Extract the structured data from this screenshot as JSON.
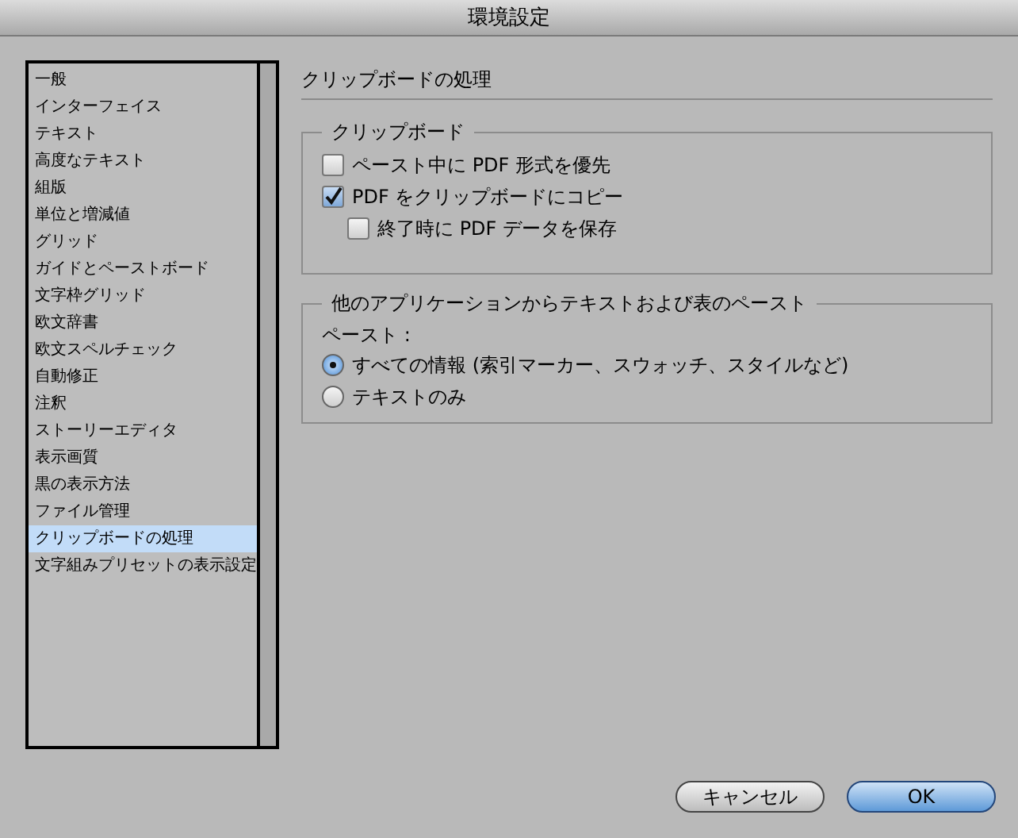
{
  "window": {
    "title": "環境設定"
  },
  "sidebar": {
    "items": [
      {
        "label": "一般",
        "selected": false
      },
      {
        "label": "インターフェイス",
        "selected": false
      },
      {
        "label": "テキスト",
        "selected": false
      },
      {
        "label": "高度なテキスト",
        "selected": false
      },
      {
        "label": "組版",
        "selected": false
      },
      {
        "label": "単位と増減値",
        "selected": false
      },
      {
        "label": "グリッド",
        "selected": false
      },
      {
        "label": "ガイドとペーストボード",
        "selected": false
      },
      {
        "label": "文字枠グリッド",
        "selected": false
      },
      {
        "label": "欧文辞書",
        "selected": false
      },
      {
        "label": "欧文スペルチェック",
        "selected": false
      },
      {
        "label": "自動修正",
        "selected": false
      },
      {
        "label": "注釈",
        "selected": false
      },
      {
        "label": "ストーリーエディタ",
        "selected": false
      },
      {
        "label": "表示画質",
        "selected": false
      },
      {
        "label": "黒の表示方法",
        "selected": false
      },
      {
        "label": "ファイル管理",
        "selected": false
      },
      {
        "label": "クリップボードの処理",
        "selected": true
      },
      {
        "label": "文字組みプリセットの表示設定",
        "selected": false
      }
    ]
  },
  "panel": {
    "title": "クリップボードの処理",
    "clipboard": {
      "legend": "クリップボード",
      "options": [
        {
          "label": "ペースト中に PDF 形式を優先",
          "checked": false
        },
        {
          "label": "PDF をクリップボードにコピー",
          "checked": true,
          "children": [
            {
              "label": "終了時に PDF データを保存",
              "checked": false
            }
          ]
        }
      ]
    },
    "paste": {
      "legend": "他のアプリケーションからテキストおよび表のペースト",
      "caption": "ペースト :",
      "options": [
        {
          "label": "すべての情報 (索引マーカー、スウォッチ、スタイルなど)",
          "selected": true
        },
        {
          "label": "テキストのみ",
          "selected": false
        }
      ]
    }
  },
  "buttons": [
    {
      "label": "キャンセル",
      "kind": "secondary"
    },
    {
      "label": "OK",
      "kind": "primary"
    }
  ]
}
